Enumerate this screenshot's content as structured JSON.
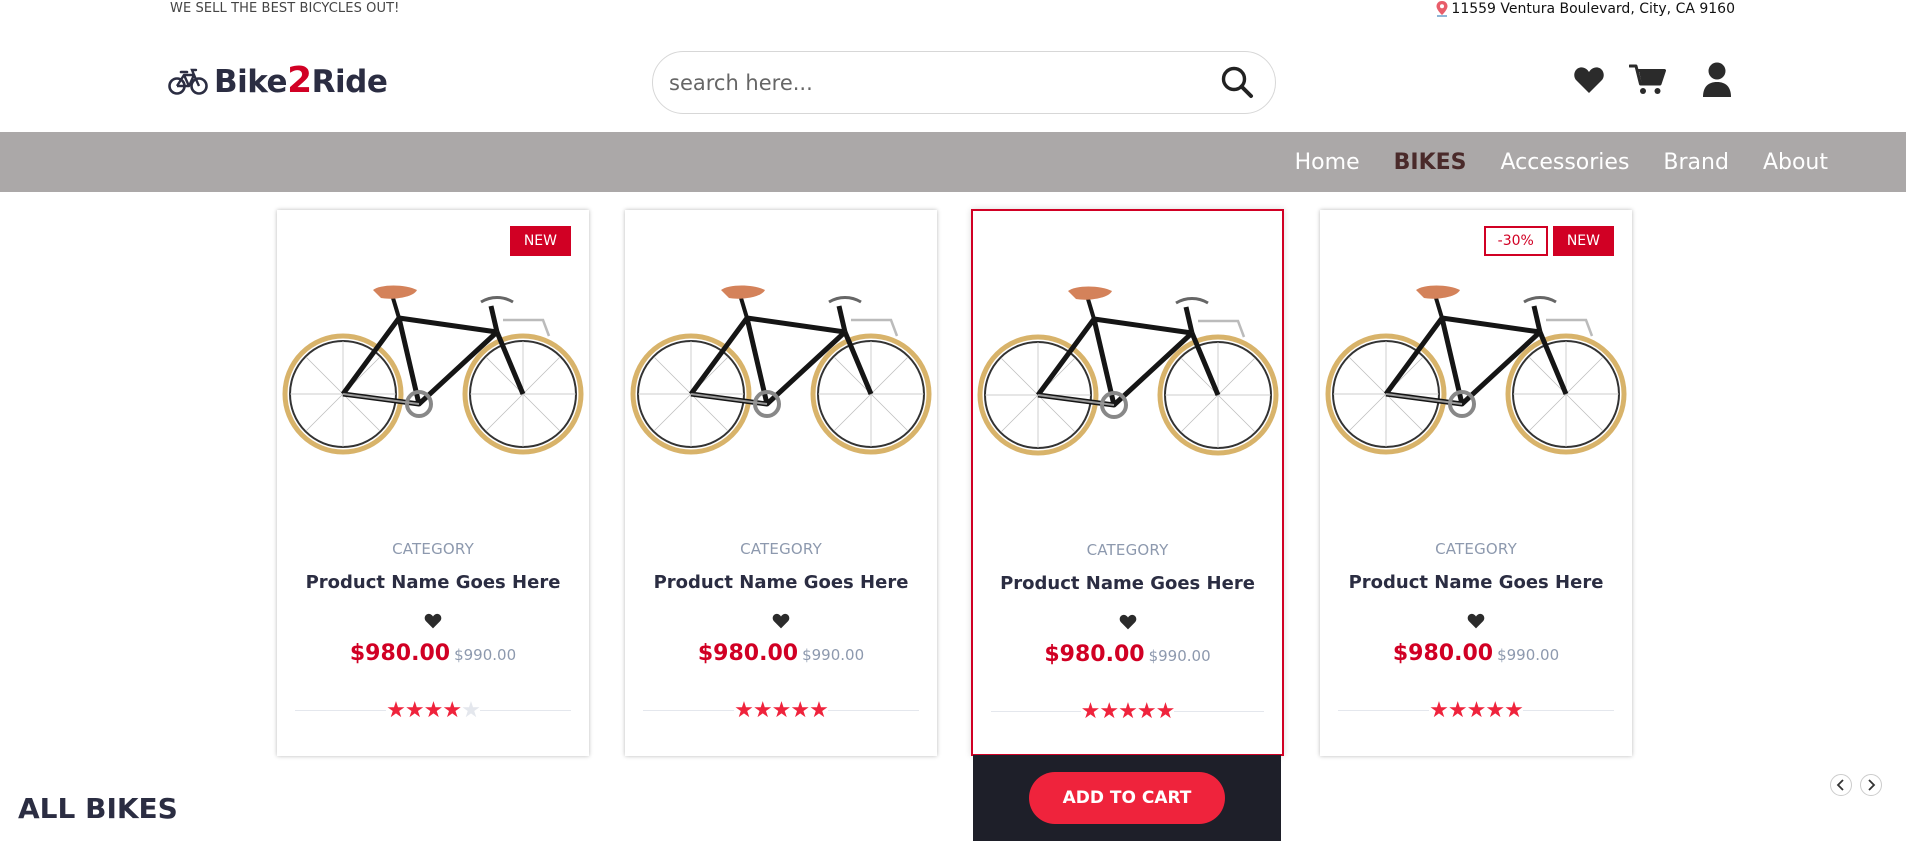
{
  "topbar": {
    "tagline": "WE SELL THE BEST BICYCLES OUT!",
    "address": "11559 Ventura Boulevard, City, CA 9160",
    "address_icon": "map-pin-icon"
  },
  "brand": {
    "name_part1": "Bike",
    "name_part2": "2",
    "name_part3": "Ride",
    "logo_icon": "bicycle-icon",
    "accent_color": "#d10024"
  },
  "search": {
    "placeholder": "search here...",
    "value": "",
    "button_icon": "search-icon"
  },
  "header_icons": [
    "heart-icon",
    "cart-icon",
    "user-icon"
  ],
  "nav": {
    "items": [
      {
        "label": "Home",
        "active": false
      },
      {
        "label": "BIKES",
        "active": true
      },
      {
        "label": "Accessories",
        "active": false
      },
      {
        "label": "Brand",
        "active": false
      },
      {
        "label": "About",
        "active": false
      }
    ],
    "background": "#aba8a8"
  },
  "products": [
    {
      "category": "CATEGORY",
      "name": "Product Name Goes Here",
      "price": "$980.00",
      "old_price": "$990.00",
      "rating": 4,
      "badges": {
        "sale": "",
        "new": "NEW"
      }
    },
    {
      "category": "CATEGORY",
      "name": "Product Name Goes Here",
      "price": "$980.00",
      "old_price": "$990.00",
      "rating": 5,
      "badges": {
        "sale": "",
        "new": ""
      }
    },
    {
      "category": "CATEGORY",
      "name": "Product Name Goes Here",
      "price": "$980.00",
      "old_price": "$990.00",
      "rating": 5,
      "badges": {
        "sale": "",
        "new": ""
      }
    },
    {
      "category": "CATEGORY",
      "name": "Product Name Goes Here",
      "price": "$980.00",
      "old_price": "$990.00",
      "rating": 5,
      "badges": {
        "sale": "-30%",
        "new": "NEW"
      }
    }
  ],
  "add_to_cart": {
    "label": "ADD TO CART"
  },
  "section": {
    "title": "ALL BIKES"
  },
  "slider": {
    "prev_icon": "chevron-left-icon",
    "next_icon": "chevron-right-icon"
  },
  "colors": {
    "price": "#d10024",
    "star": "#ef233c",
    "cart_button": "#ef233c",
    "cart_panel": "#1e1f29"
  }
}
